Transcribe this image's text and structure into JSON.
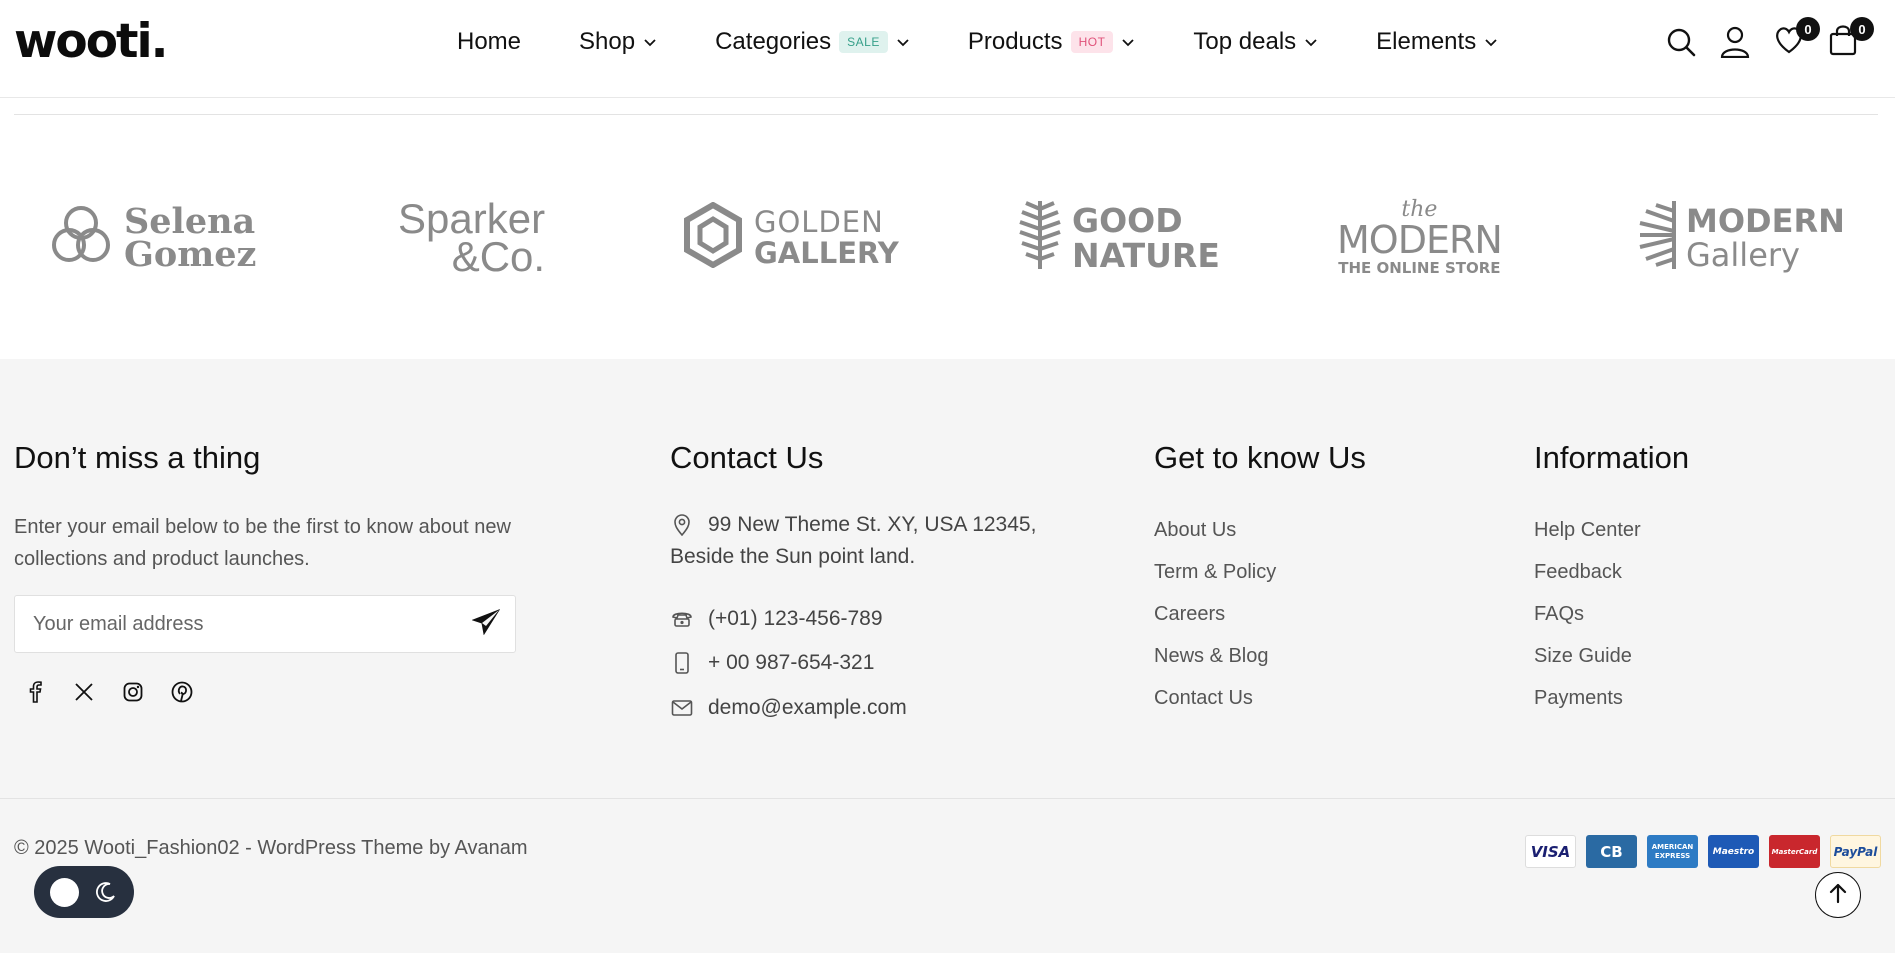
{
  "header": {
    "logo": "wooti.",
    "nav": [
      {
        "label": "Home",
        "has_dropdown": false,
        "badge": ""
      },
      {
        "label": "Shop",
        "has_dropdown": true,
        "badge": ""
      },
      {
        "label": "Categories",
        "has_dropdown": true,
        "badge": "SALE"
      },
      {
        "label": "Products",
        "has_dropdown": true,
        "badge": "HOT"
      },
      {
        "label": "Top deals",
        "has_dropdown": true,
        "badge": ""
      },
      {
        "label": "Elements",
        "has_dropdown": true,
        "badge": ""
      }
    ],
    "icons": [
      "search-icon",
      "user-icon",
      "heart-icon",
      "bag-icon"
    ],
    "wishlist_count": "0",
    "cart_count": "0"
  },
  "brands": [
    {
      "line1": "Selena",
      "line2": "Gomez"
    },
    {
      "line1": "Sparker",
      "line2": "&Co."
    },
    {
      "line1": "GOLDEN",
      "line2": "GALLERY"
    },
    {
      "line1": "GOOD",
      "line2": "NATURE"
    },
    {
      "line0": "the",
      "line1": "MODERN",
      "line2": "THE ONLINE STORE"
    },
    {
      "line1": "MODERN",
      "line2": "Gallery"
    }
  ],
  "footer": {
    "newsletter": {
      "title": "Don’t miss a thing",
      "description": "Enter your email below to be the first to know about new collections and product launches.",
      "placeholder": "Your email address",
      "socials": [
        "facebook-icon",
        "x-icon",
        "instagram-icon",
        "pinterest-icon"
      ]
    },
    "contact": {
      "title": "Contact Us",
      "address_line1": "99 New Theme St. XY, USA 12345,",
      "address_line2": "Beside the Sun point land.",
      "phone": "(+01) 123-456-789",
      "mobile": "+ 00 987-654-321",
      "email": "demo@example.com"
    },
    "know_us": {
      "title": "Get to know Us",
      "links": [
        "About Us",
        "Term & Policy",
        "Careers",
        "News & Blog",
        "Contact Us"
      ]
    },
    "information": {
      "title": "Information",
      "links": [
        "Help Center",
        "Feedback",
        "FAQs",
        "Size Guide",
        "Payments"
      ]
    },
    "copyright": "© 2025 Wooti_Fashion02 - WordPress Theme by Avanam",
    "payments": [
      {
        "label": "VISA",
        "color": "#ffffff",
        "text_color": "#1a1f71"
      },
      {
        "label": "CB",
        "color": "#2a6aa3",
        "text_color": "#ffffff"
      },
      {
        "label": "AMERICAN EXPRESS",
        "color": "#2d7bc4",
        "text_color": "#ffffff"
      },
      {
        "label": "Maestro",
        "color": "#1e5ab6",
        "text_color": "#ffffff"
      },
      {
        "label": "MasterCard",
        "color": "#c9272d",
        "text_color": "#ffffff"
      },
      {
        "label": "PayPal",
        "color": "#fff6e0",
        "text_color": "#1d4d9b"
      }
    ]
  },
  "colors": {
    "footer_bg": "#f5f5f5",
    "toggle_bg": "#27303f",
    "sale_badge": "#37a08a",
    "hot_badge": "#e0527a",
    "brand_gray": "#8a8a8a"
  }
}
